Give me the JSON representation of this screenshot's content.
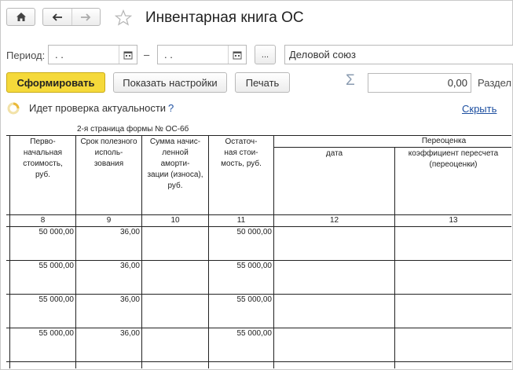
{
  "window": {
    "title": "Инвентарная книга ОС"
  },
  "filters": {
    "period_label": "Период:",
    "date_from": " .  .",
    "date_to": " .  .",
    "dash": "–",
    "ellipsis": "...",
    "organization": "Деловой союз"
  },
  "toolbar": {
    "generate": "Сформировать",
    "show_settings": "Показать настройки",
    "print": "Печать",
    "sum_symbol": "Σ",
    "sum_value": "0,00",
    "section_cut": "Раздел"
  },
  "status": {
    "checking_text": "Идет проверка актуальности",
    "help": "?",
    "hide_link": "Скрыть"
  },
  "report": {
    "form_page_title": "2-я страница формы № ОС-6б",
    "headers": {
      "initial_cost": "Перво-\nначальная\nстоимость,\nруб.",
      "useful_life": "Срок полезного\nисполь-\nзования",
      "depreciation": "Сумма начис-\nленной\nаморти-\nзации (износа),\nруб.",
      "residual_cost": "Остаточ-\nная стои-\nмость, руб.",
      "revaluation": "Переоценка",
      "date": "дата",
      "coefficient": "коэффициент пересчета\n(переоценки)"
    },
    "col_numbers": [
      "8",
      "9",
      "10",
      "11",
      "12",
      "13"
    ],
    "rows": [
      {
        "initial_cost": "50 000,00",
        "useful_life": "36,00",
        "residual_cost": "50 000,00"
      },
      {
        "initial_cost": "55 000,00",
        "useful_life": "36,00",
        "residual_cost": "55 000,00"
      },
      {
        "initial_cost": "55 000,00",
        "useful_life": "36,00",
        "residual_cost": "55 000,00"
      },
      {
        "initial_cost": "55 000,00",
        "useful_life": "36,00",
        "residual_cost": "55 000,00"
      }
    ]
  },
  "colors": {
    "accent_button": "#f5d93a",
    "link": "#1d4fa0"
  }
}
